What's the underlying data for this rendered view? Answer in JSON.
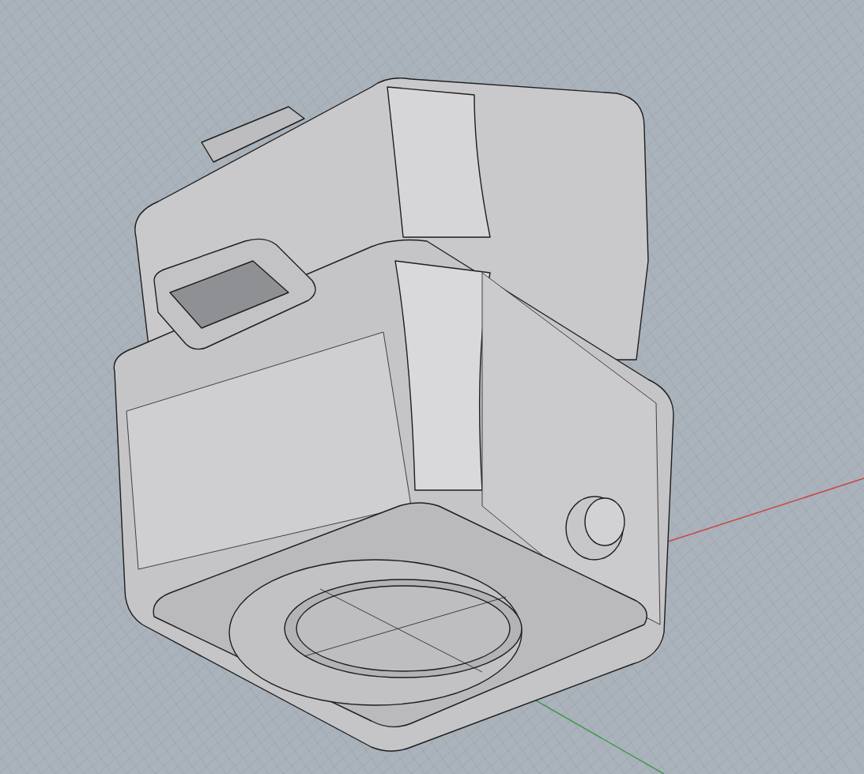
{
  "viewport": {
    "axes": [
      {
        "kind": "x",
        "color": "#c8464a"
      },
      {
        "kind": "y",
        "color": "#3f9a4a"
      }
    ]
  }
}
